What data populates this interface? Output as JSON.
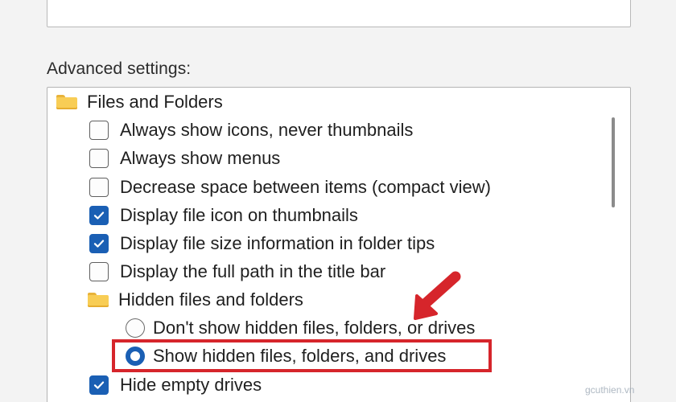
{
  "section_label": "Advanced settings:",
  "tree": {
    "group_files": "Files and Folders",
    "items": [
      {
        "label": "Always show icons, never thumbnails",
        "checked": false
      },
      {
        "label": "Always show menus",
        "checked": false
      },
      {
        "label": "Decrease space between items (compact view)",
        "checked": false
      },
      {
        "label": "Display file icon on thumbnails",
        "checked": true
      },
      {
        "label": "Display file size information in folder tips",
        "checked": true
      },
      {
        "label": "Display the full path in the title bar",
        "checked": false
      }
    ],
    "group_hidden": "Hidden files and folders",
    "radios": [
      {
        "label": "Don't show hidden files, folders, or drives",
        "selected": false
      },
      {
        "label": "Show hidden files, folders, and drives",
        "selected": true
      }
    ],
    "last_item": {
      "label": "Hide empty drives",
      "checked": true
    }
  },
  "watermark": "gcuthien.vn",
  "colors": {
    "accent": "#1a5fb4",
    "highlight": "#d6252b",
    "folder": "#f8cd55"
  },
  "icons": {
    "folder": "folder-icon",
    "checkbox": "checkbox",
    "radio": "radio-button",
    "arrow": "annotation-arrow"
  }
}
